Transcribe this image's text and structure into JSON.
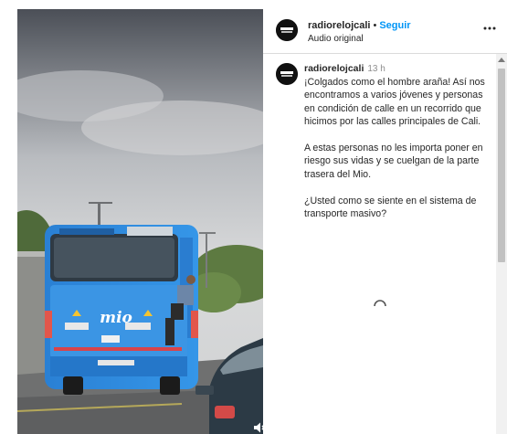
{
  "post": {
    "account": "radiorelojcali",
    "follow_label": "Seguir",
    "separator": "•",
    "audio_label": "Audio original",
    "more_icon": "more-horizontal-icon"
  },
  "caption": {
    "username": "radiorelojcali",
    "time": "13 h",
    "paragraphs": [
      "¡Colgados como el hombre araña! Así nos encontramos a varios jóvenes y personas en condición de calle en un recorrido que hicimos por las calles principales de Cali.",
      "A estas personas no les importa poner en riesgo sus vidas y se cuelgan de la parte trasera del Mio.",
      "¿Usted como se siente en el sistema de transporte masivo?"
    ]
  },
  "video": {
    "bus_logo_text": "mio",
    "bus_color": "#2f8fe0",
    "muted_icon": "speaker-muted-icon"
  },
  "colors": {
    "accent": "#0095f6",
    "text": "#262626",
    "secondary": "#8e8e8e"
  }
}
